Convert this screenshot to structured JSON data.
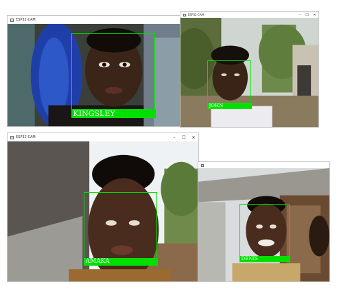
{
  "windows": [
    {
      "title": "ESP32-CAM",
      "face_label": "KINGSLEY"
    },
    {
      "title": "ESP32-CAM",
      "face_label": "JOHN"
    },
    {
      "title": "ESP32-CAM",
      "face_label": "AMAKA"
    },
    {
      "title": "",
      "face_label": "DENIS"
    }
  ],
  "controls": {
    "minimize": "–",
    "maximize": "☐",
    "close": "✕"
  },
  "colors": {
    "detection_box": "#00e000",
    "label_text": "#ffffff"
  }
}
